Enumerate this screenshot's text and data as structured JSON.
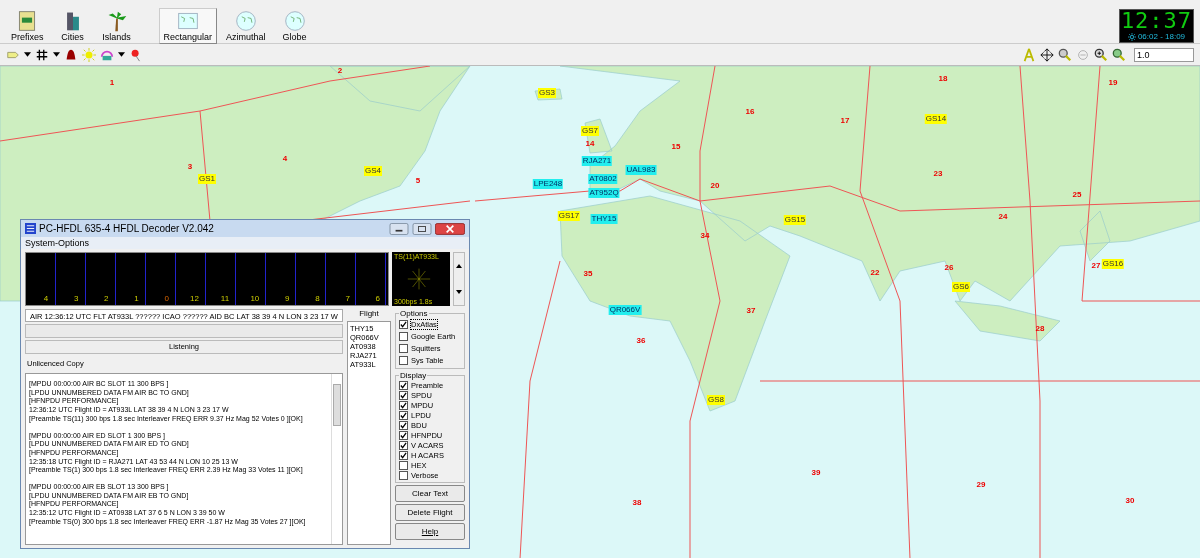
{
  "toolbar": {
    "buttons": [
      {
        "label": "Prefixes",
        "kind": "book",
        "selected": false
      },
      {
        "label": "Cities",
        "kind": "city",
        "selected": false
      },
      {
        "label": "Islands",
        "kind": "palm",
        "selected": false
      },
      {
        "label": "Rectangular",
        "kind": "rect",
        "selected": true
      },
      {
        "label": "Azimuthal",
        "kind": "globe",
        "selected": false
      },
      {
        "label": "Globe",
        "kind": "globe",
        "selected": false
      }
    ]
  },
  "clock": {
    "time": "12:37",
    "sun": "06:02 - 18:09"
  },
  "zoom_field": {
    "value": "1.0"
  },
  "map": {
    "zones": [
      "1",
      "2",
      "3",
      "4",
      "5",
      "14",
      "15",
      "16",
      "17",
      "18",
      "19",
      "20",
      "22",
      "23",
      "24",
      "25",
      "26",
      "27",
      "28",
      "29",
      "30",
      "34",
      "35",
      "36",
      "37",
      "38",
      "39"
    ],
    "ground_stations": [
      "GS3",
      "GS7",
      "GS1",
      "GS4",
      "GS17",
      "GS15",
      "GS14",
      "GS16",
      "GS6",
      "GS8"
    ],
    "flights": [
      "RJA271",
      "AT0802",
      "UAL983",
      "LPE248",
      "AT952Q",
      "THY15",
      "QR066V"
    ]
  },
  "decoder": {
    "title": "PC-HFDL 635-4 HFDL Decoder V2.042",
    "menu": "System-Options",
    "slots": [
      {
        "label": "4",
        "selected": false
      },
      {
        "label": "3",
        "selected": false
      },
      {
        "label": "2",
        "selected": false
      },
      {
        "label": "1",
        "selected": false
      },
      {
        "label": "0",
        "selected": true
      },
      {
        "label": "12",
        "selected": false
      },
      {
        "label": "11",
        "selected": false
      },
      {
        "label": "10",
        "selected": false
      },
      {
        "label": "9",
        "selected": false
      },
      {
        "label": "8",
        "selected": false
      },
      {
        "label": "7",
        "selected": false
      },
      {
        "label": "6",
        "selected": false
      }
    ],
    "constellation": {
      "title": "TS(11)AT933L",
      "rate": "300bps 1.8s"
    },
    "status_line": "AIR 12:36:12  UTC FLT AT933L  ?????? ICAO ?????? AID BC LAT 38 39 4  N  LON 3 23 17  W",
    "state": "Listening",
    "license": "Unlicenced Copy",
    "log": [
      [
        "[MPDU 00:00:00 AIR BC SLOT 11 300 BPS ]",
        "[LPDU UNNUMBERED DATA FM AIR BC TO GND]",
        "[HFNPDU PERFORMANCE]",
        "12:36:12  UTC  Flight ID = AT933L  LAT 38 39 4  N  LON 3 23 17  W",
        "[Preamble TS(11) 300  bps 1.8 sec Interleaver FREQ ERR 9.37 Hz Mag 52 Votes 0 ][OK]"
      ],
      [
        "[MPDU 00:00:00 AIR ED SLOT 1 300 BPS ]",
        "[LPDU UNNUMBERED DATA FM AIR ED TO GND]",
        "[HFNPDU PERFORMANCE]",
        "12:35:18  UTC  Flight ID = RJA271  LAT 43 53 44  N  LON 10 25 13  W",
        "[Preamble TS(1) 300  bps 1.8 sec Interleaver FREQ ERR 2.39 Hz Mag 33 Votes 11 ][OK]"
      ],
      [
        "[MPDU 00:00:00 AIR EB SLOT 13 300 BPS ]",
        "[LPDU UNNUMBERED DATA FM AIR EB TO GND]",
        "[HFNPDU PERFORMANCE]",
        "12:35:12  UTC  Flight ID = AT0938  LAT 37 6 5  N  LON 3 39 50  W",
        "[Preamble TS(0) 300  bps 1.8 sec Interleaver FREQ ERR -1.87 Hz Mag 35 Votes 27 ][OK]"
      ]
    ],
    "flight_heading": "Flight",
    "flights": [
      "THY15",
      "QR066V",
      "AT0938",
      "RJA271",
      "AT933L"
    ],
    "options": {
      "title": "Options",
      "items": [
        {
          "label": "DxAtlas",
          "checked": true
        },
        {
          "label": "Google Earth",
          "checked": false
        },
        {
          "label": "Squitters",
          "checked": false
        },
        {
          "label": "Sys Table",
          "checked": false
        }
      ]
    },
    "display": {
      "title": "Display",
      "items": [
        {
          "label": "Preamble",
          "checked": true
        },
        {
          "label": "SPDU",
          "checked": true
        },
        {
          "label": "MPDU",
          "checked": true
        },
        {
          "label": "LPDU",
          "checked": true
        },
        {
          "label": "BDU",
          "checked": true
        },
        {
          "label": "HFNPDU",
          "checked": true
        },
        {
          "label": "V ACARS",
          "checked": true
        },
        {
          "label": "H ACARS",
          "checked": true
        },
        {
          "label": "HEX",
          "checked": false
        },
        {
          "label": "Verbose",
          "checked": false
        }
      ]
    },
    "buttons": [
      "Clear Text",
      "Delete Flight",
      "Help"
    ]
  }
}
